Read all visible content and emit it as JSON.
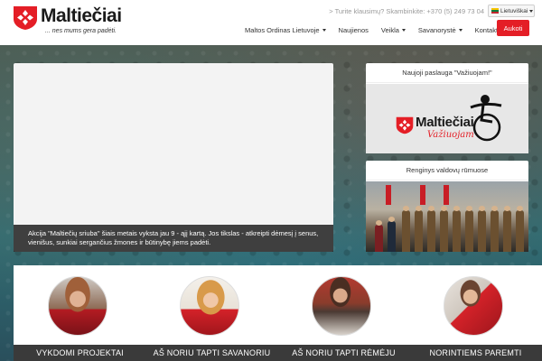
{
  "header": {
    "logo_name": "Maltiečiai",
    "logo_tagline": "... nes mums gera padėti.",
    "contact_text": "> Turite klausimų? Skambinkite: +370 (5) 249 73 04",
    "language": "Lietuviškai",
    "nav": [
      {
        "label": "Maltos Ordinas Lietuvoje",
        "dropdown": true
      },
      {
        "label": "Naujienos",
        "dropdown": false
      },
      {
        "label": "Veikla",
        "dropdown": true
      },
      {
        "label": "Savanorystė",
        "dropdown": true
      },
      {
        "label": "Kontaktai",
        "dropdown": true
      }
    ],
    "donate_label": "Aukoti"
  },
  "video": {
    "caption": "Akcija \"Maltiečių sriuba\" šiais metais vyksta jau 9 - ąjį kartą. Jos tikslas - atkreipti dėmesį į senus, vienišus, sunkiai sergančius žmones ir būtinybę jiems padėti."
  },
  "widgets": [
    {
      "title": "Naujoji paslauga \"Važiuojam!\"",
      "brand_name": "Maltiečiai",
      "brand_script": "Važiuojam"
    },
    {
      "title": "Renginys valdovų rūmuose"
    }
  ],
  "cards": [
    {
      "label": "VYKDOMI PROJEKTAI"
    },
    {
      "label": "AŠ NORIU TAPTI SAVANORIU"
    },
    {
      "label": "AŠ NORIU TAPTI RĖMĖJU"
    },
    {
      "label": "NORINTIEMS PAREMTI"
    }
  ],
  "colors": {
    "brand_red": "#e41e26",
    "dark_label": "#3a3a3a"
  }
}
